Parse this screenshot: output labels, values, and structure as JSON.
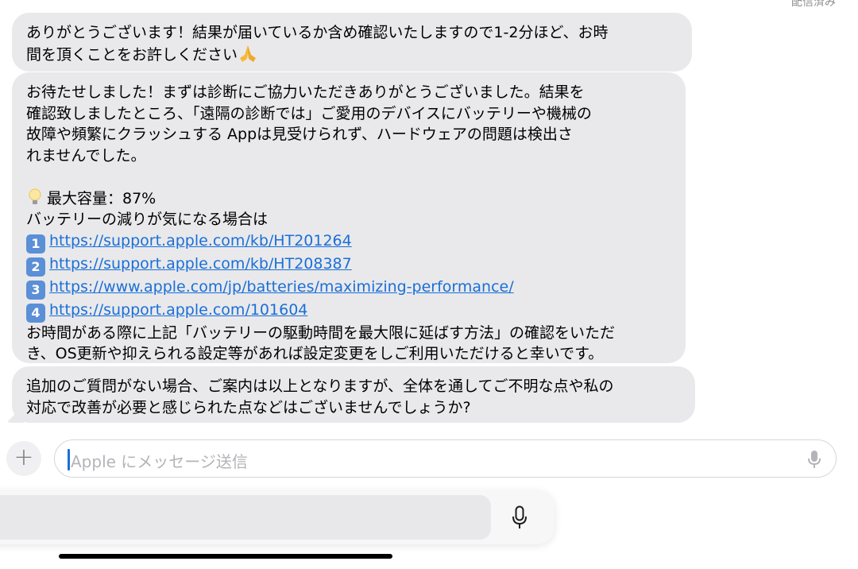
{
  "status": {
    "delivered": "配信済み"
  },
  "messages": [
    {
      "lines": [
        "ありがとうございます！結果が届いているか含め確認いたしますので1-2分ほど、お時",
        "間を頂くことをお許しください"
      ],
      "trailing_emoji": "folded-hands-icon"
    },
    {
      "intro": [
        "お待たせしました！まずは診断にご協力いただきありがとうございました。結果を",
        "確認致しましたところ、「遠隔の診断では」ご愛用のデバイスにバッテリーや機械の",
        "故障や頻繁にクラッシュする Appは見受けられず、ハードウェアの問題は検出さ",
        "れませんでした。"
      ],
      "capacity": "最大容量：87%",
      "battery_note": "バッテリーの減りが気になる場合は",
      "links": [
        {
          "num": "1",
          "url": "https://support.apple.com/kb/HT201264"
        },
        {
          "num": "2",
          "url": "https://support.apple.com/kb/HT208387"
        },
        {
          "num": "3",
          "url": "https://www.apple.com/jp/batteries/maximizing-performance/"
        },
        {
          "num": "4",
          "url": "https://support.apple.com/101604"
        }
      ],
      "outro": [
        "お時間がある際に上記「バッテリーの駆動時間を最大限に延ばす方法」の確認をいただ",
        "き、OS更新や抑えられる設定等があれば設定変更をしご利用いただけると幸いです。"
      ]
    },
    {
      "lines": [
        "追加のご質問がない場合、ご案内は以上となりますが、全体を通してご不明な点や私の",
        "対応で改善が必要と感じられた点などはございませんでしょうか?"
      ]
    }
  ],
  "composer": {
    "plus_label": "+",
    "placeholder": "Apple にメッセージ送信"
  }
}
